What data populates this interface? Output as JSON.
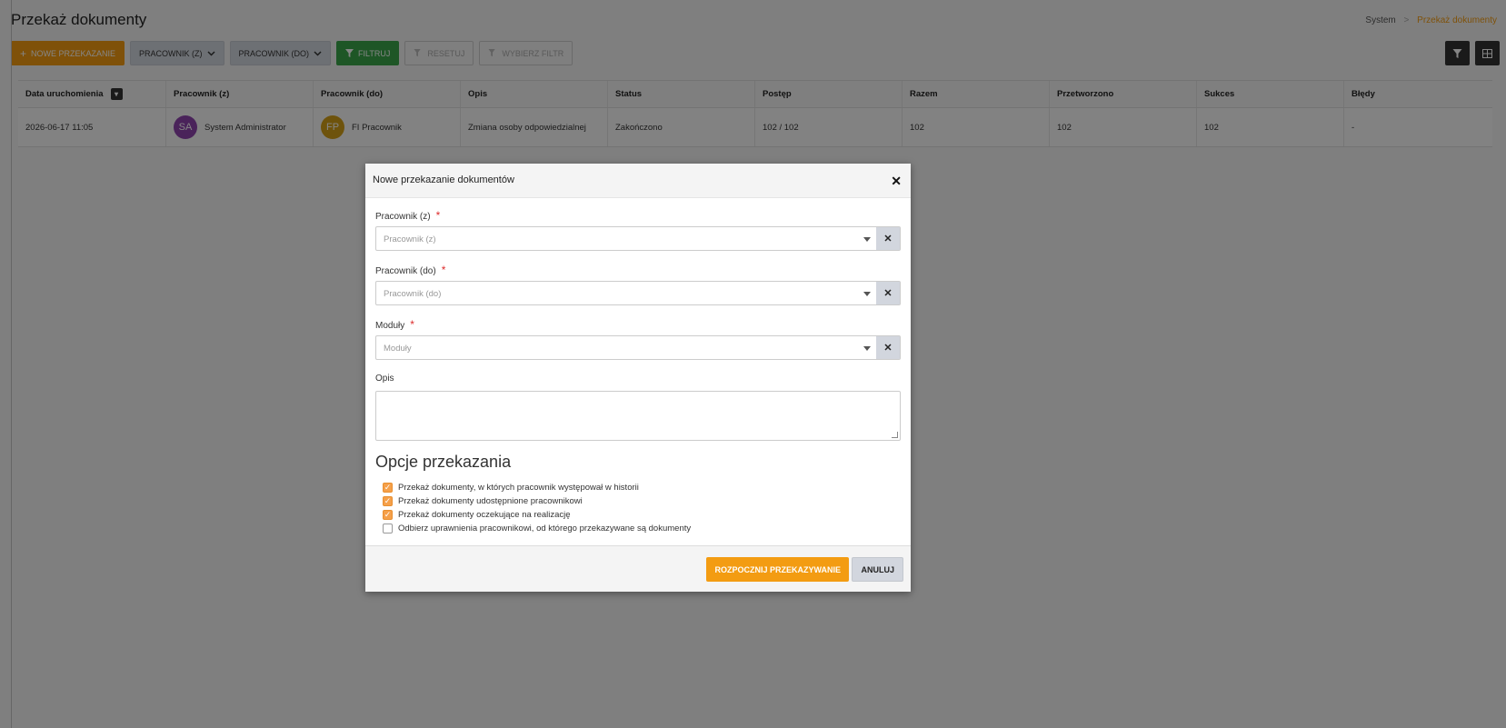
{
  "page": {
    "title": "Przekaż dokumenty",
    "breadcrumb": {
      "root": "System",
      "separator": ">",
      "current": "Przekaż dokumenty"
    }
  },
  "toolbar": {
    "new_transfer": "Nowe przekazanie",
    "employee_from": "Pracownik (z)",
    "employee_to": "Pracownik (do)",
    "filter": "Filtruj",
    "reset": "Resetuj",
    "choose_filter": "Wybierz filtr"
  },
  "grid": {
    "columns": [
      "Data uruchomienia",
      "Pracownik (z)",
      "Pracownik (do)",
      "Opis",
      "Status",
      "Postęp",
      "Razem",
      "Przetworzono",
      "Sukces",
      "Błędy"
    ],
    "rows": [
      {
        "date": "2026-06-17 11:05",
        "from": {
          "initials": "SA",
          "name": "System Administrator",
          "color": "#8e44ad"
        },
        "to": {
          "initials": "FP",
          "name": "FI Pracownik",
          "color": "#d4a017"
        },
        "description": "Zmiana osoby odpowiedzialnej",
        "status": "Zakończono",
        "progress": "102 / 102",
        "total": "102",
        "processed": "102",
        "success": "102",
        "errors": "-"
      }
    ]
  },
  "modal": {
    "title": "Nowe przekazanie dokumentów",
    "fields": {
      "from_label": "Pracownik (z)",
      "from_placeholder": "Pracownik (z)",
      "to_label": "Pracownik (do)",
      "to_placeholder": "Pracownik (do)",
      "modules_label": "Moduły",
      "modules_placeholder": "Moduły",
      "description_label": "Opis",
      "required_mark": "*"
    },
    "options_title": "Opcje przekazania",
    "options": [
      {
        "label": "Przekaż dokumenty, w których pracownik występował w historii",
        "checked": true
      },
      {
        "label": "Przekaż dokumenty udostępnione pracownikowi",
        "checked": true
      },
      {
        "label": "Przekaż dokumenty oczekujące na realizację",
        "checked": true
      },
      {
        "label": "Odbierz uprawnienia pracownikowi, od którego przekazywane są dokumenty",
        "checked": false
      }
    ],
    "start_button": "Rozpocznij przekazywanie",
    "cancel_button": "Anuluj"
  },
  "colors": {
    "accent": "#f39c12",
    "filter": "#3aa64a",
    "required": "#dd2c2c"
  },
  "icons": [
    "plus-icon",
    "chevron-down-icon",
    "filter-icon",
    "close-icon",
    "caret-down-icon",
    "check-icon",
    "grid-icon",
    "sort-icon"
  ]
}
